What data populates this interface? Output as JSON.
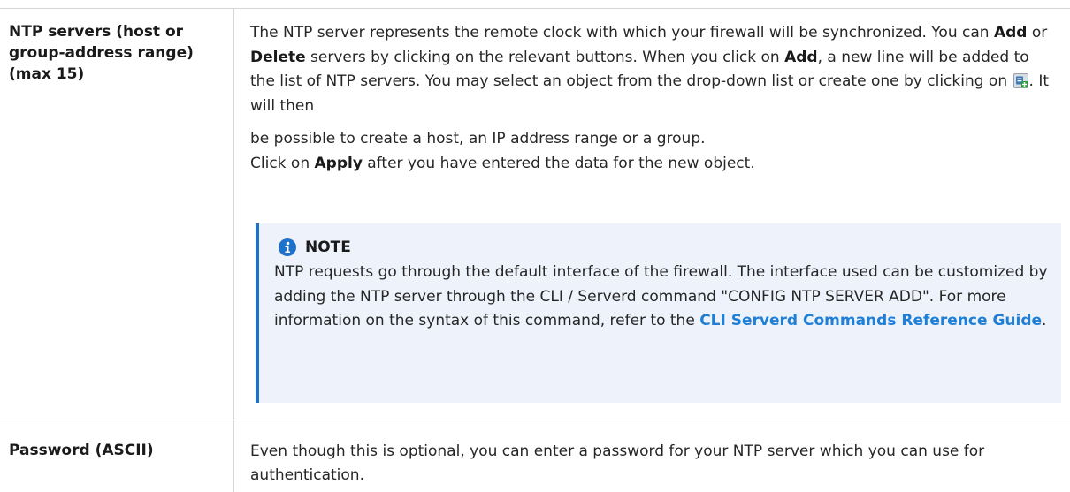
{
  "rows": [
    {
      "term": "NTP servers (host or group-address range) (max 15)",
      "desc": {
        "p1_a": "The NTP server represents the remote clock with which your firewall will be synchronized. You can ",
        "p1_add": "Add",
        "p1_b": " or ",
        "p1_delete": "Delete",
        "p1_c": " servers by clicking on the relevant buttons. When you click on ",
        "p1_add2": "Add",
        "p1_d": ", a new line will be added to the list of NTP servers. You may select an object from the drop-down list or create one by clicking on ",
        "p1_e": ". It will then",
        "p2": "be possible to create a host, an IP address range or a group.",
        "p3_a": "Click on ",
        "p3_apply": "Apply",
        "p3_b": " after you have entered the data for the new object."
      },
      "note": {
        "title": "NOTE",
        "body": "NTP requests go through the default interface of the firewall. The interface used can be customized by adding the NTP server through the CLI / Serverd command \"CONFIG NTP SERVER ADD\". For more information on the syntax of this command, refer to the ",
        "link": "CLI Serverd Commands Reference Guide",
        "tail": "."
      }
    },
    {
      "term": "Password (ASCII)",
      "desc": "Even though this is optional, you can enter a password for your NTP server which you can use for authentication."
    }
  ],
  "colors": {
    "note_bg": "#eef3fb",
    "note_border": "#1f72c9",
    "link": "#1f7fd6",
    "rule": "#d6d6d6"
  },
  "icons": {
    "create_object": "add-object-icon",
    "note": "info-icon"
  }
}
